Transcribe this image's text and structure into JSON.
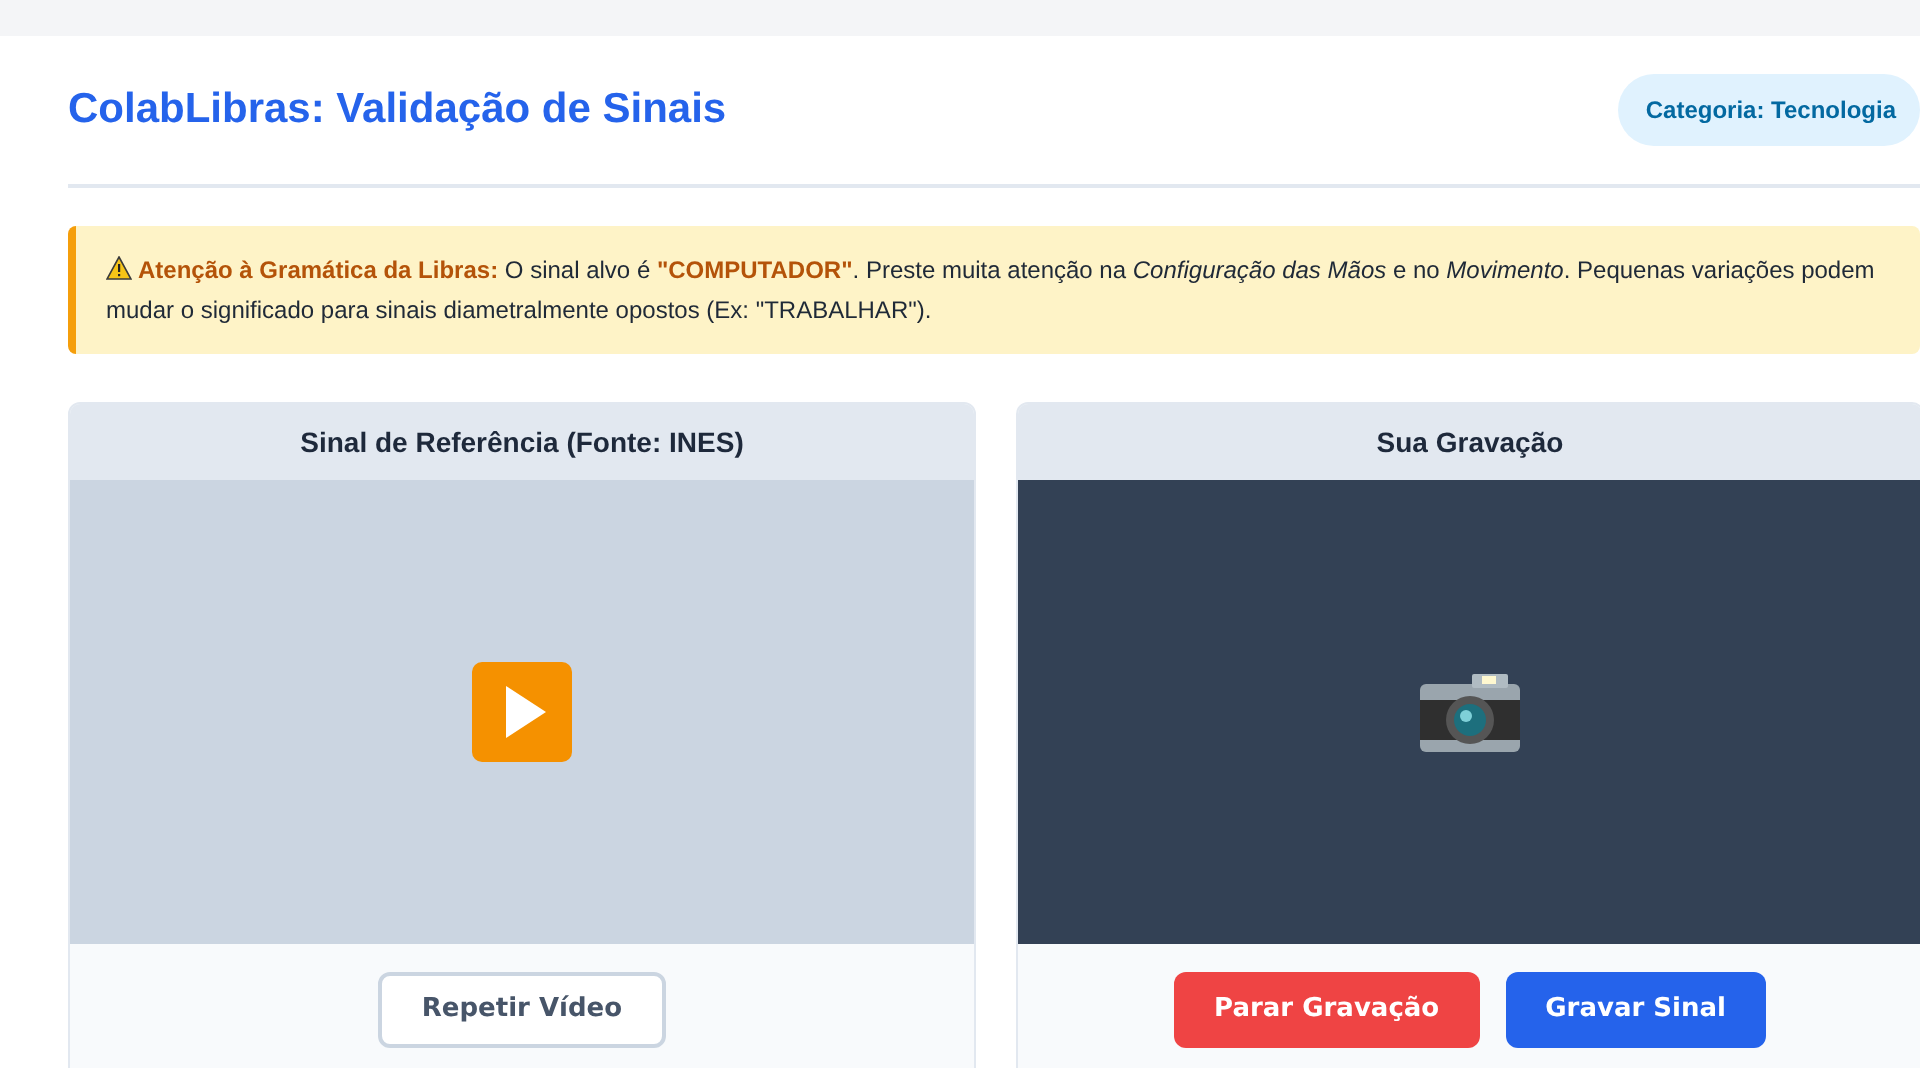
{
  "header": {
    "title": "ColabLibras: Validação de Sinais",
    "badge": "Categoria: Tecnologia"
  },
  "alert": {
    "text": "**Atenção à Gramática da Libras:** O sinal alvo é **\"COMPUTADOR\"**. Preste muita atenção na *Configuração das Mãos* e no *Movimento*. Pequenas variações podem mudar o significado para sinais diametralmente opostos (Ex: \"TRABALHAR\")."
  },
  "panels": [
    {
      "title": "Sinal de Referência (Fonte: INES)",
      "kind": "reference",
      "buttons": [
        {
          "label": "Repetir Vídeo",
          "kind": "outline"
        }
      ]
    },
    {
      "title": "Sua Gravação",
      "kind": "camera",
      "buttons": [
        {
          "label": "Parar Gravação",
          "kind": "danger"
        },
        {
          "label": "Gravar Sinal",
          "kind": "primary"
        }
      ]
    }
  ]
}
